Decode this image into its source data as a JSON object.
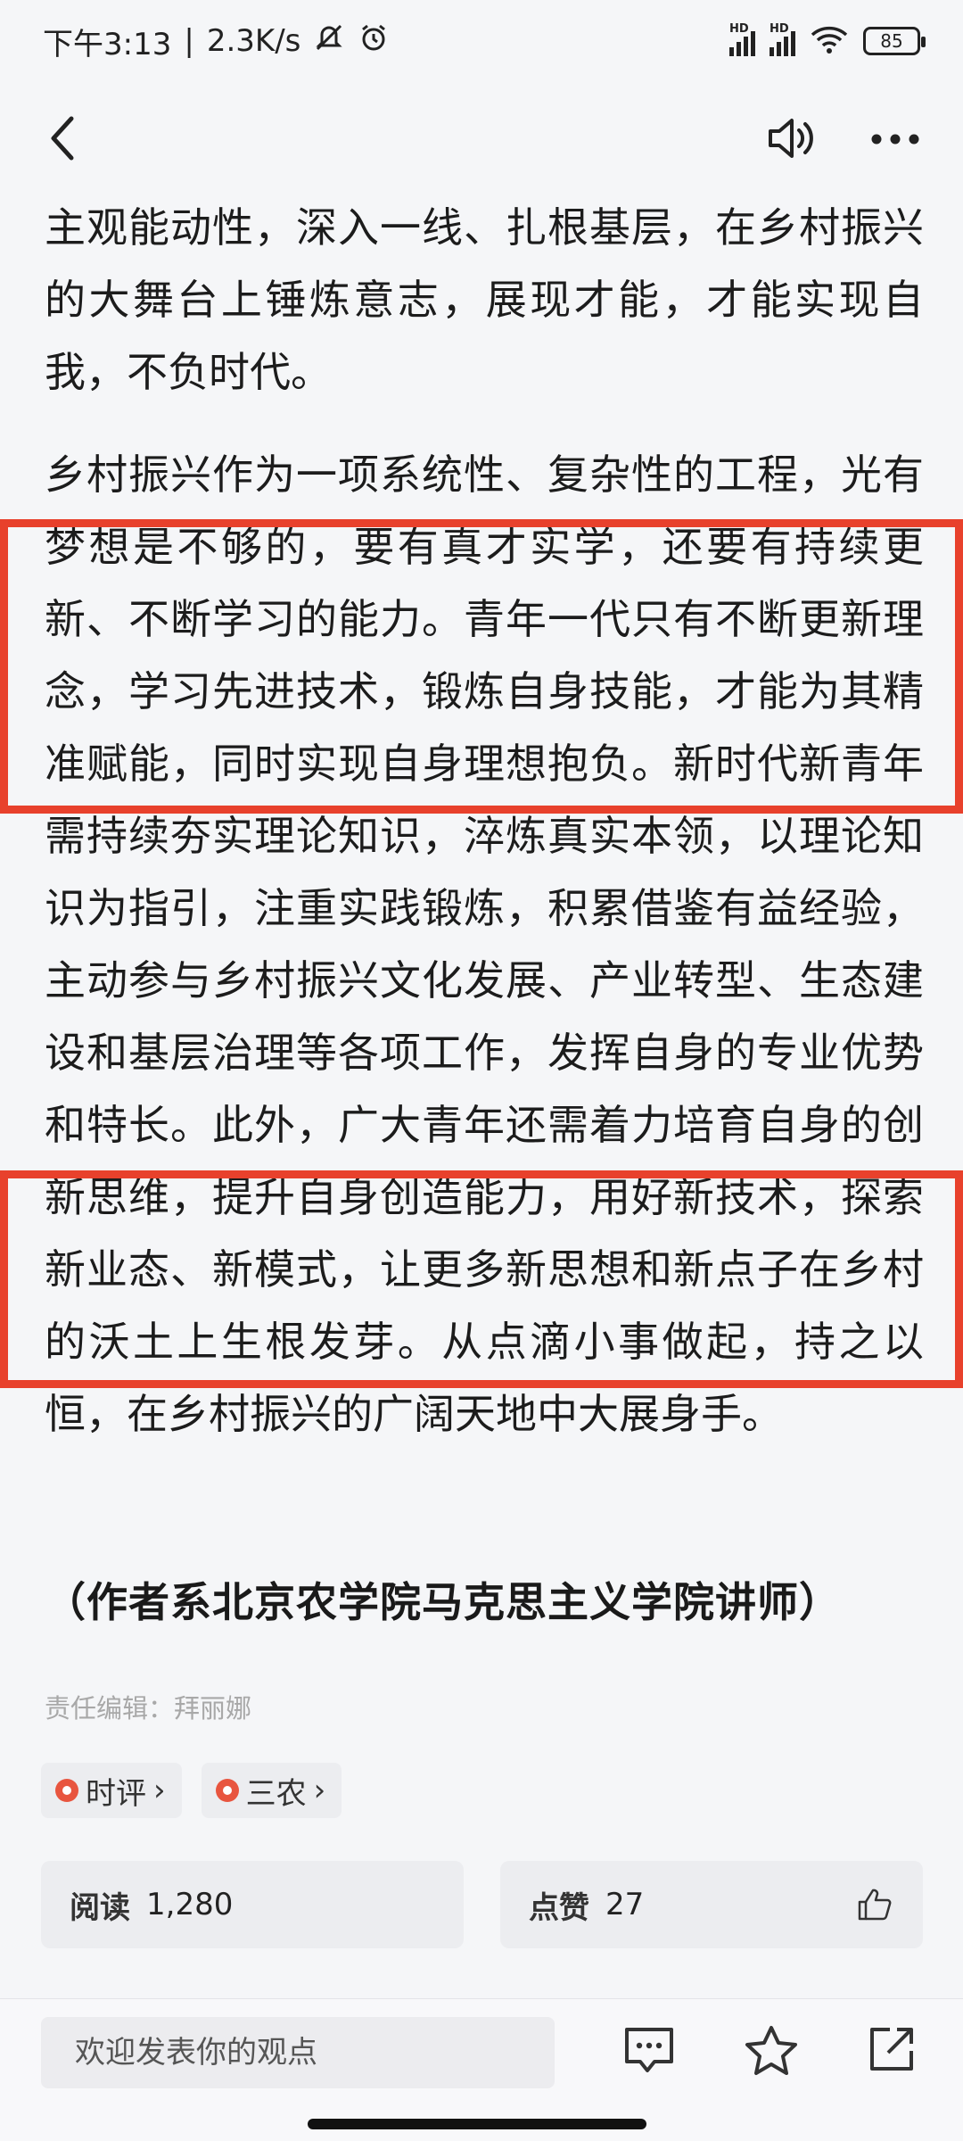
{
  "status_bar": {
    "time": "下午3:13",
    "separator": "|",
    "net_speed": "2.3K/s",
    "signal_label": "HD",
    "battery": "85"
  },
  "icons": {
    "back": "chevron-left-icon",
    "speaker": "speaker-icon",
    "more": "more-dots-icon",
    "comment": "comment-icon",
    "star": "star-icon",
    "share": "share-icon",
    "thumb": "thumbs-up-icon"
  },
  "article": {
    "paragraphs": [
      "主观能动性，深入一线、扎根基层，在乡村振兴的大舞台上锤炼意志，展现才能，才能实现自我，不负时代。",
      "乡村振兴作为一项系统性、复杂性的工程，光有梦想是不够的，要有真才实学，还要有持续更新、不断学习的能力。青年一代只有不断更新理念，学习先进技术，锻炼自身技能，才能为其精准赋能，同时实现自身理想抱负。新时代新青年需持续夯实理论知识，淬炼真实本领，以理论知识为指引，注重实践锻炼，积累借鉴有益经验，主动参与乡村振兴文化发展、产业转型、生态建设和基层治理等各项工作，发挥自身的专业优势和特长。此外，广大青年还需着力培育自身的创新思维，提升自身创造能力，用好新技术，探索新业态、新模式，让更多新思想和新点子在乡村的沃土上生根发芽。从点滴小事做起，持之以恒，在乡村振兴的广阔天地中大展身手。"
    ],
    "author_note": "（作者系北京农学院马克思主义学院讲师）",
    "editor": "责任编辑：拜丽娜"
  },
  "tags": [
    {
      "label": "时评",
      "chevron": "›"
    },
    {
      "label": "三农",
      "chevron": "›"
    }
  ],
  "stats": {
    "read_label": "阅读",
    "read_value": "1,280",
    "like_label": "点赞",
    "like_value": "27"
  },
  "comment": {
    "placeholder": "欢迎发表你的观点"
  },
  "colors": {
    "highlight": "#e8412c",
    "tag_pin": "#e8553f"
  }
}
